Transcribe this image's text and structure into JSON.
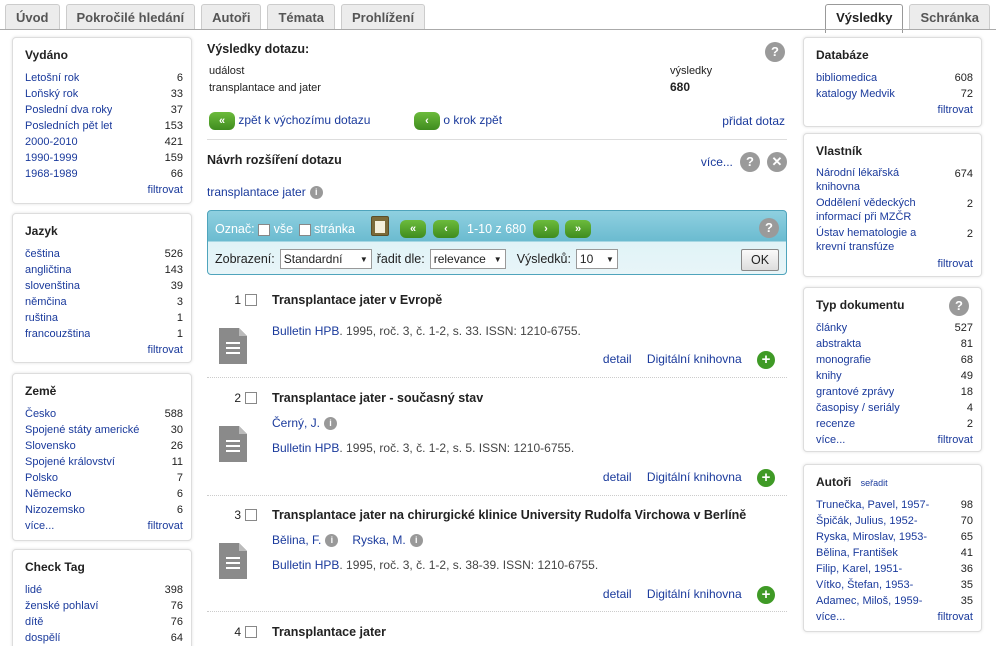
{
  "tabs_left": [
    "Úvod",
    "Pokročilé hledání",
    "Autoři",
    "Témata",
    "Prohlížení"
  ],
  "tabs_right": [
    "Výsledky",
    "Schránka"
  ],
  "left_boxes": [
    {
      "title": "Vydáno",
      "items": [
        {
          "label": "Letošní rok",
          "count": "6"
        },
        {
          "label": "Loňský rok",
          "count": "33"
        },
        {
          "label": "Poslední dva roky",
          "count": "37"
        },
        {
          "label": "Posledních pět let",
          "count": "153"
        },
        {
          "label": "2000-2010",
          "count": "421"
        },
        {
          "label": "1990-1999",
          "count": "159"
        },
        {
          "label": "1968-1989",
          "count": "66"
        }
      ],
      "filter": "filtrovat"
    },
    {
      "title": "Jazyk",
      "items": [
        {
          "label": "čeština",
          "count": "526"
        },
        {
          "label": "angličtina",
          "count": "143"
        },
        {
          "label": "slovenština",
          "count": "39"
        },
        {
          "label": "němčina",
          "count": "3"
        },
        {
          "label": "ruština",
          "count": "1"
        },
        {
          "label": "francouzština",
          "count": "1"
        }
      ],
      "filter": "filtrovat"
    },
    {
      "title": "Země",
      "items": [
        {
          "label": "Česko",
          "count": "588"
        },
        {
          "label": "Spojené státy americké",
          "count": "30"
        },
        {
          "label": "Slovensko",
          "count": "26"
        },
        {
          "label": "Spojené království",
          "count": "11"
        },
        {
          "label": "Polsko",
          "count": "7"
        },
        {
          "label": "Německo",
          "count": "6"
        },
        {
          "label": "Nizozemsko",
          "count": "6"
        }
      ],
      "more": "více...",
      "filter": "filtrovat"
    },
    {
      "title": "Check Tag",
      "items": [
        {
          "label": "lidé",
          "count": "398"
        },
        {
          "label": "ženské pohlaví",
          "count": "76"
        },
        {
          "label": "dítě",
          "count": "76"
        },
        {
          "label": "dospělí",
          "count": "64"
        }
      ]
    }
  ],
  "right_boxes": [
    {
      "title": "Databáze",
      "items": [
        {
          "label": "bibliomedica",
          "count": "608"
        },
        {
          "label": "katalogy Medvik",
          "count": "72"
        }
      ],
      "filter": "filtrovat"
    },
    {
      "title": "Vlastník",
      "items": [
        {
          "label": "Národní lékařská knihovna",
          "count": "674"
        },
        {
          "label": "Oddělení vědeckých informací při MZČR",
          "count": "2"
        },
        {
          "label": "Ústav hematologie a krevní transfúze",
          "count": "2"
        }
      ],
      "filter": "filtrovat"
    },
    {
      "title": "Typ dokumentu",
      "help": "?",
      "items": [
        {
          "label": "články",
          "count": "527"
        },
        {
          "label": "abstrakta",
          "count": "81"
        },
        {
          "label": "monografie",
          "count": "68"
        },
        {
          "label": "knihy",
          "count": "49"
        },
        {
          "label": "grantové zprávy",
          "count": "18"
        },
        {
          "label": "časopisy / seriály",
          "count": "4"
        },
        {
          "label": "recenze",
          "count": "2"
        }
      ],
      "more": "více...",
      "filter": "filtrovat"
    },
    {
      "title": "Autoři",
      "sort": "seřadit",
      "items": [
        {
          "label": "Trunečka, Pavel, 1957-",
          "count": "98"
        },
        {
          "label": "Špičák, Julius, 1952-",
          "count": "70"
        },
        {
          "label": "Ryska, Miroslav, 1953-",
          "count": "65"
        },
        {
          "label": "Bělina, František",
          "count": "41"
        },
        {
          "label": "Filip, Karel, 1951-",
          "count": "36"
        },
        {
          "label": "Vítko, Štefan, 1953-",
          "count": "35"
        },
        {
          "label": "Adamec, Miloš, 1959-",
          "count": "35"
        }
      ],
      "more": "více...",
      "filter": "filtrovat"
    }
  ],
  "query": {
    "heading": "Výsledky dotazu:",
    "col_event": "událost",
    "col_results": "výsledky",
    "query_text": "transplantace and jater",
    "result_count": "680",
    "back_initial": "zpět k výchozímu dotazu",
    "back_step": "o krok zpět",
    "add_query": "přidat dotaz",
    "help": "?"
  },
  "suggest": {
    "heading": "Návrh rozšíření dotazu",
    "more": "více...",
    "term": "transplantace jater"
  },
  "toolbar": {
    "mark_label": "Označ:",
    "all_label": "vše",
    "page_label": "stránka",
    "range": "1-10 z 680",
    "display_label": "Zobrazení:",
    "display_value": "Standardní",
    "sort_label": "řadit dle:",
    "sort_value": "relevance",
    "results_label": "Výsledků:",
    "results_value": "10",
    "ok_label": "OK"
  },
  "records": [
    {
      "num": "1",
      "title": "Transplantace jater v Evropě",
      "authors": [],
      "journal": "Bulletin HPB",
      "details": ". 1995, roč. 3, č. 1-2, s. 33. ISSN: 1210-6755.",
      "detail_link": "detail",
      "library_link": "Digitální knihovna"
    },
    {
      "num": "2",
      "title": "Transplantace jater - současný stav",
      "authors": [
        "Černý, J."
      ],
      "journal": "Bulletin HPB",
      "details": ". 1995, roč. 3, č. 1-2, s. 5. ISSN: 1210-6755.",
      "detail_link": "detail",
      "library_link": "Digitální knihovna"
    },
    {
      "num": "3",
      "title": "Transplantace jater na chirurgické klinice University Rudolfa Virchowa v Berlíně",
      "authors": [
        "Bělina, F.",
        "Ryska, M."
      ],
      "journal": "Bulletin HPB",
      "details": ". 1995, roč. 3, č. 1-2, s. 38-39. ISSN: 1210-6755.",
      "detail_link": "detail",
      "library_link": "Digitální knihovna"
    },
    {
      "num": "4",
      "title": "Transplantace jater"
    }
  ]
}
